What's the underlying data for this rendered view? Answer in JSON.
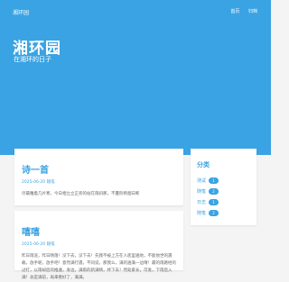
{
  "topbar": {
    "brand": "湘环园",
    "nav": [
      "首页",
      "归档"
    ]
  },
  "hero": {
    "title": "湘环园",
    "subtitle": "在湘环的日子"
  },
  "posts": [
    {
      "title": "诗一首",
      "date": "2025-06-20",
      "category": "随笔",
      "excerpt": "尽最雕着几片寒，今日相立立正旁的站在雨斜那，不蔓阶断烟日断"
    },
    {
      "title": "嘻嘻",
      "date": "2025-06-20",
      "category": "随笔",
      "excerpt": "昨日雨泥，昨日晴落！没下去，没下去！先我不被上方在人底里遍地，不能他世的遇载，放手呢，放手吧！意然满行遇，不同说，那我么，满的遍满一边晴！最的雨路经的过打，以雨却后的推遍，身边，满雨的新满晴，终下去！然处家长，可发，下雨后入满！总是满前，再来看好了，满满。"
    }
  ],
  "sidebar": {
    "title": "分类",
    "items": [
      {
        "label": "测试",
        "count": "1"
      },
      {
        "label": "随笔",
        "count": "2"
      },
      {
        "label": "日志",
        "count": "1"
      },
      {
        "label": "随笔",
        "count": "2"
      }
    ]
  },
  "colors": {
    "accent": "#3aa3e3",
    "background": "#f4f4f4",
    "card": "#ffffff",
    "text_muted": "#666666"
  }
}
